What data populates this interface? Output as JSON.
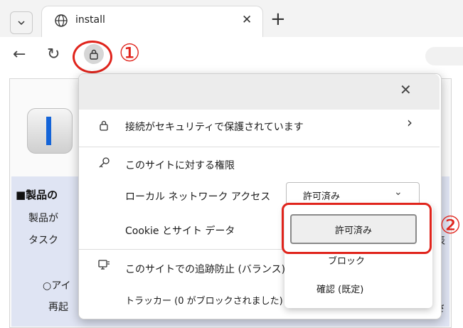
{
  "browser": {
    "tab_title": "install",
    "icons": {
      "tab_dropdown": "chevron-down-icon",
      "tab_favicon": "globe-icon",
      "tab_close": "close-icon",
      "new_tab": "plus-icon",
      "back": "back-arrow-icon",
      "reload": "reload-icon",
      "site_info": "lock-icon"
    }
  },
  "annotations": {
    "marker1": "①",
    "marker2": "②",
    "color": "#e0241c"
  },
  "page": {
    "heading": "■製品の",
    "lines": [
      "製品が",
      "タスク",
      "○アイ",
      "再起"
    ],
    "right_fragments": [
      "表",
      "さ"
    ]
  },
  "popup": {
    "connection_label": "接続がセキュリティで保護されています",
    "permissions_heading": "このサイトに対する権限",
    "local_network_label": "ローカル ネットワーク アクセス",
    "local_network_value": "許可済み",
    "cookie_label": "Cookie とサイト データ",
    "tracking_label": "このサイトでの追跡防止 (バランス)",
    "trackers_label": "トラッカー (0 がブロックされました)"
  },
  "dropdown": {
    "options": [
      "許可済み",
      "ブロック",
      "確認 (既定)"
    ],
    "selected": "許可済み"
  }
}
